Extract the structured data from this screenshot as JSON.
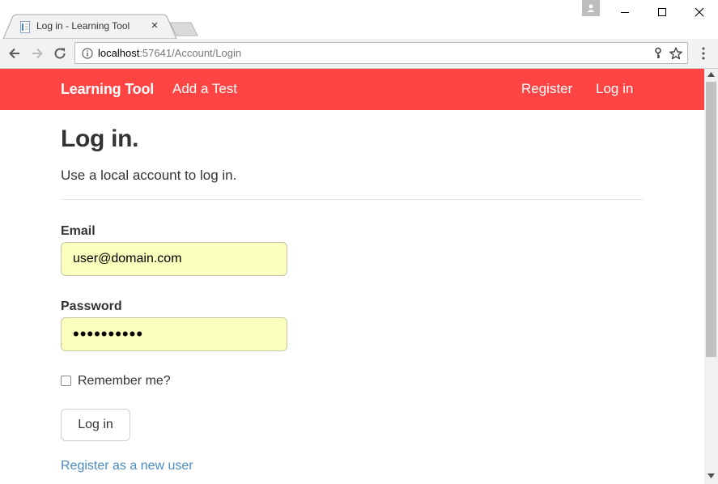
{
  "browser": {
    "tab_title": "Log in - Learning Tool",
    "tab_close": "×",
    "url_host": "localhost",
    "url_rest": ":57641/Account/Login"
  },
  "navbar": {
    "brand": "Learning Tool",
    "add_test": "Add a Test",
    "register": "Register",
    "login": "Log in",
    "background_color": "#ff4444"
  },
  "page": {
    "title": "Log in.",
    "subtitle": "Use a local account to log in."
  },
  "form": {
    "email_label": "Email",
    "email_value": "user@domain.com",
    "password_label": "Password",
    "password_value": "••••••••••",
    "remember_label": "Remember me?",
    "remember_checked": false,
    "submit_label": "Log in",
    "register_link": "Register as a new user",
    "autofill_color": "#faffbd"
  }
}
